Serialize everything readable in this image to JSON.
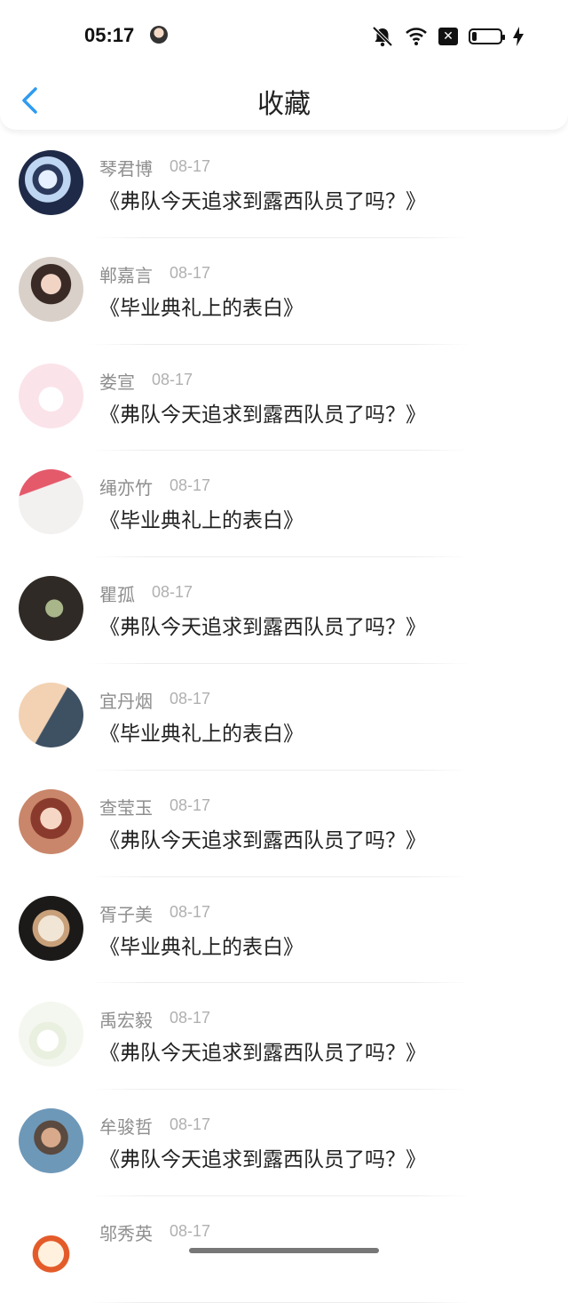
{
  "status": {
    "time": "05:17",
    "icons": [
      "avatar",
      "bell-muted-icon",
      "wifi-icon",
      "close-box-icon",
      "battery-icon",
      "charging-bolt-icon"
    ]
  },
  "header": {
    "title": "收藏",
    "back_icon": "chevron-left-icon",
    "accent_color": "#2f9bf0"
  },
  "items": [
    {
      "name": "琴君博",
      "date": "08-17",
      "topic": "《弗队今天追求到露西队员了吗？》",
      "avatar": "anime-figure"
    },
    {
      "name": "郸嘉言",
      "date": "08-17",
      "topic": "《毕业典礼上的表白》",
      "avatar": "portrait-girl"
    },
    {
      "name": "娄宣",
      "date": "08-17",
      "topic": "《弗队今天追求到露西队员了吗？》",
      "avatar": "cat-sketch"
    },
    {
      "name": "绳亦竹",
      "date": "08-17",
      "topic": "《毕业典礼上的表白》",
      "avatar": "love-note"
    },
    {
      "name": "瞿孤",
      "date": "08-17",
      "topic": "《弗队今天追求到露西队员了吗？》",
      "avatar": "paper-crane"
    },
    {
      "name": "宜丹烟",
      "date": "08-17",
      "topic": "《毕业典礼上的表白》",
      "avatar": "sunglasses-person"
    },
    {
      "name": "查莹玉",
      "date": "08-17",
      "topic": "《弗队今天追求到露西队员了吗？》",
      "avatar": "illustrated-girl"
    },
    {
      "name": "胥子美",
      "date": "08-17",
      "topic": "《毕业典礼上的表白》",
      "avatar": "food-bowl"
    },
    {
      "name": "禹宏毅",
      "date": "08-17",
      "topic": "《弗队今天追求到露西队员了吗？》",
      "avatar": "white-flower"
    },
    {
      "name": "牟骏哲",
      "date": "08-17",
      "topic": "《弗队今天追求到露西队员了吗？》",
      "avatar": "man-portrait"
    },
    {
      "name": "邬秀英",
      "date": "08-17",
      "topic": "",
      "avatar": "cartoon-kid"
    }
  ]
}
